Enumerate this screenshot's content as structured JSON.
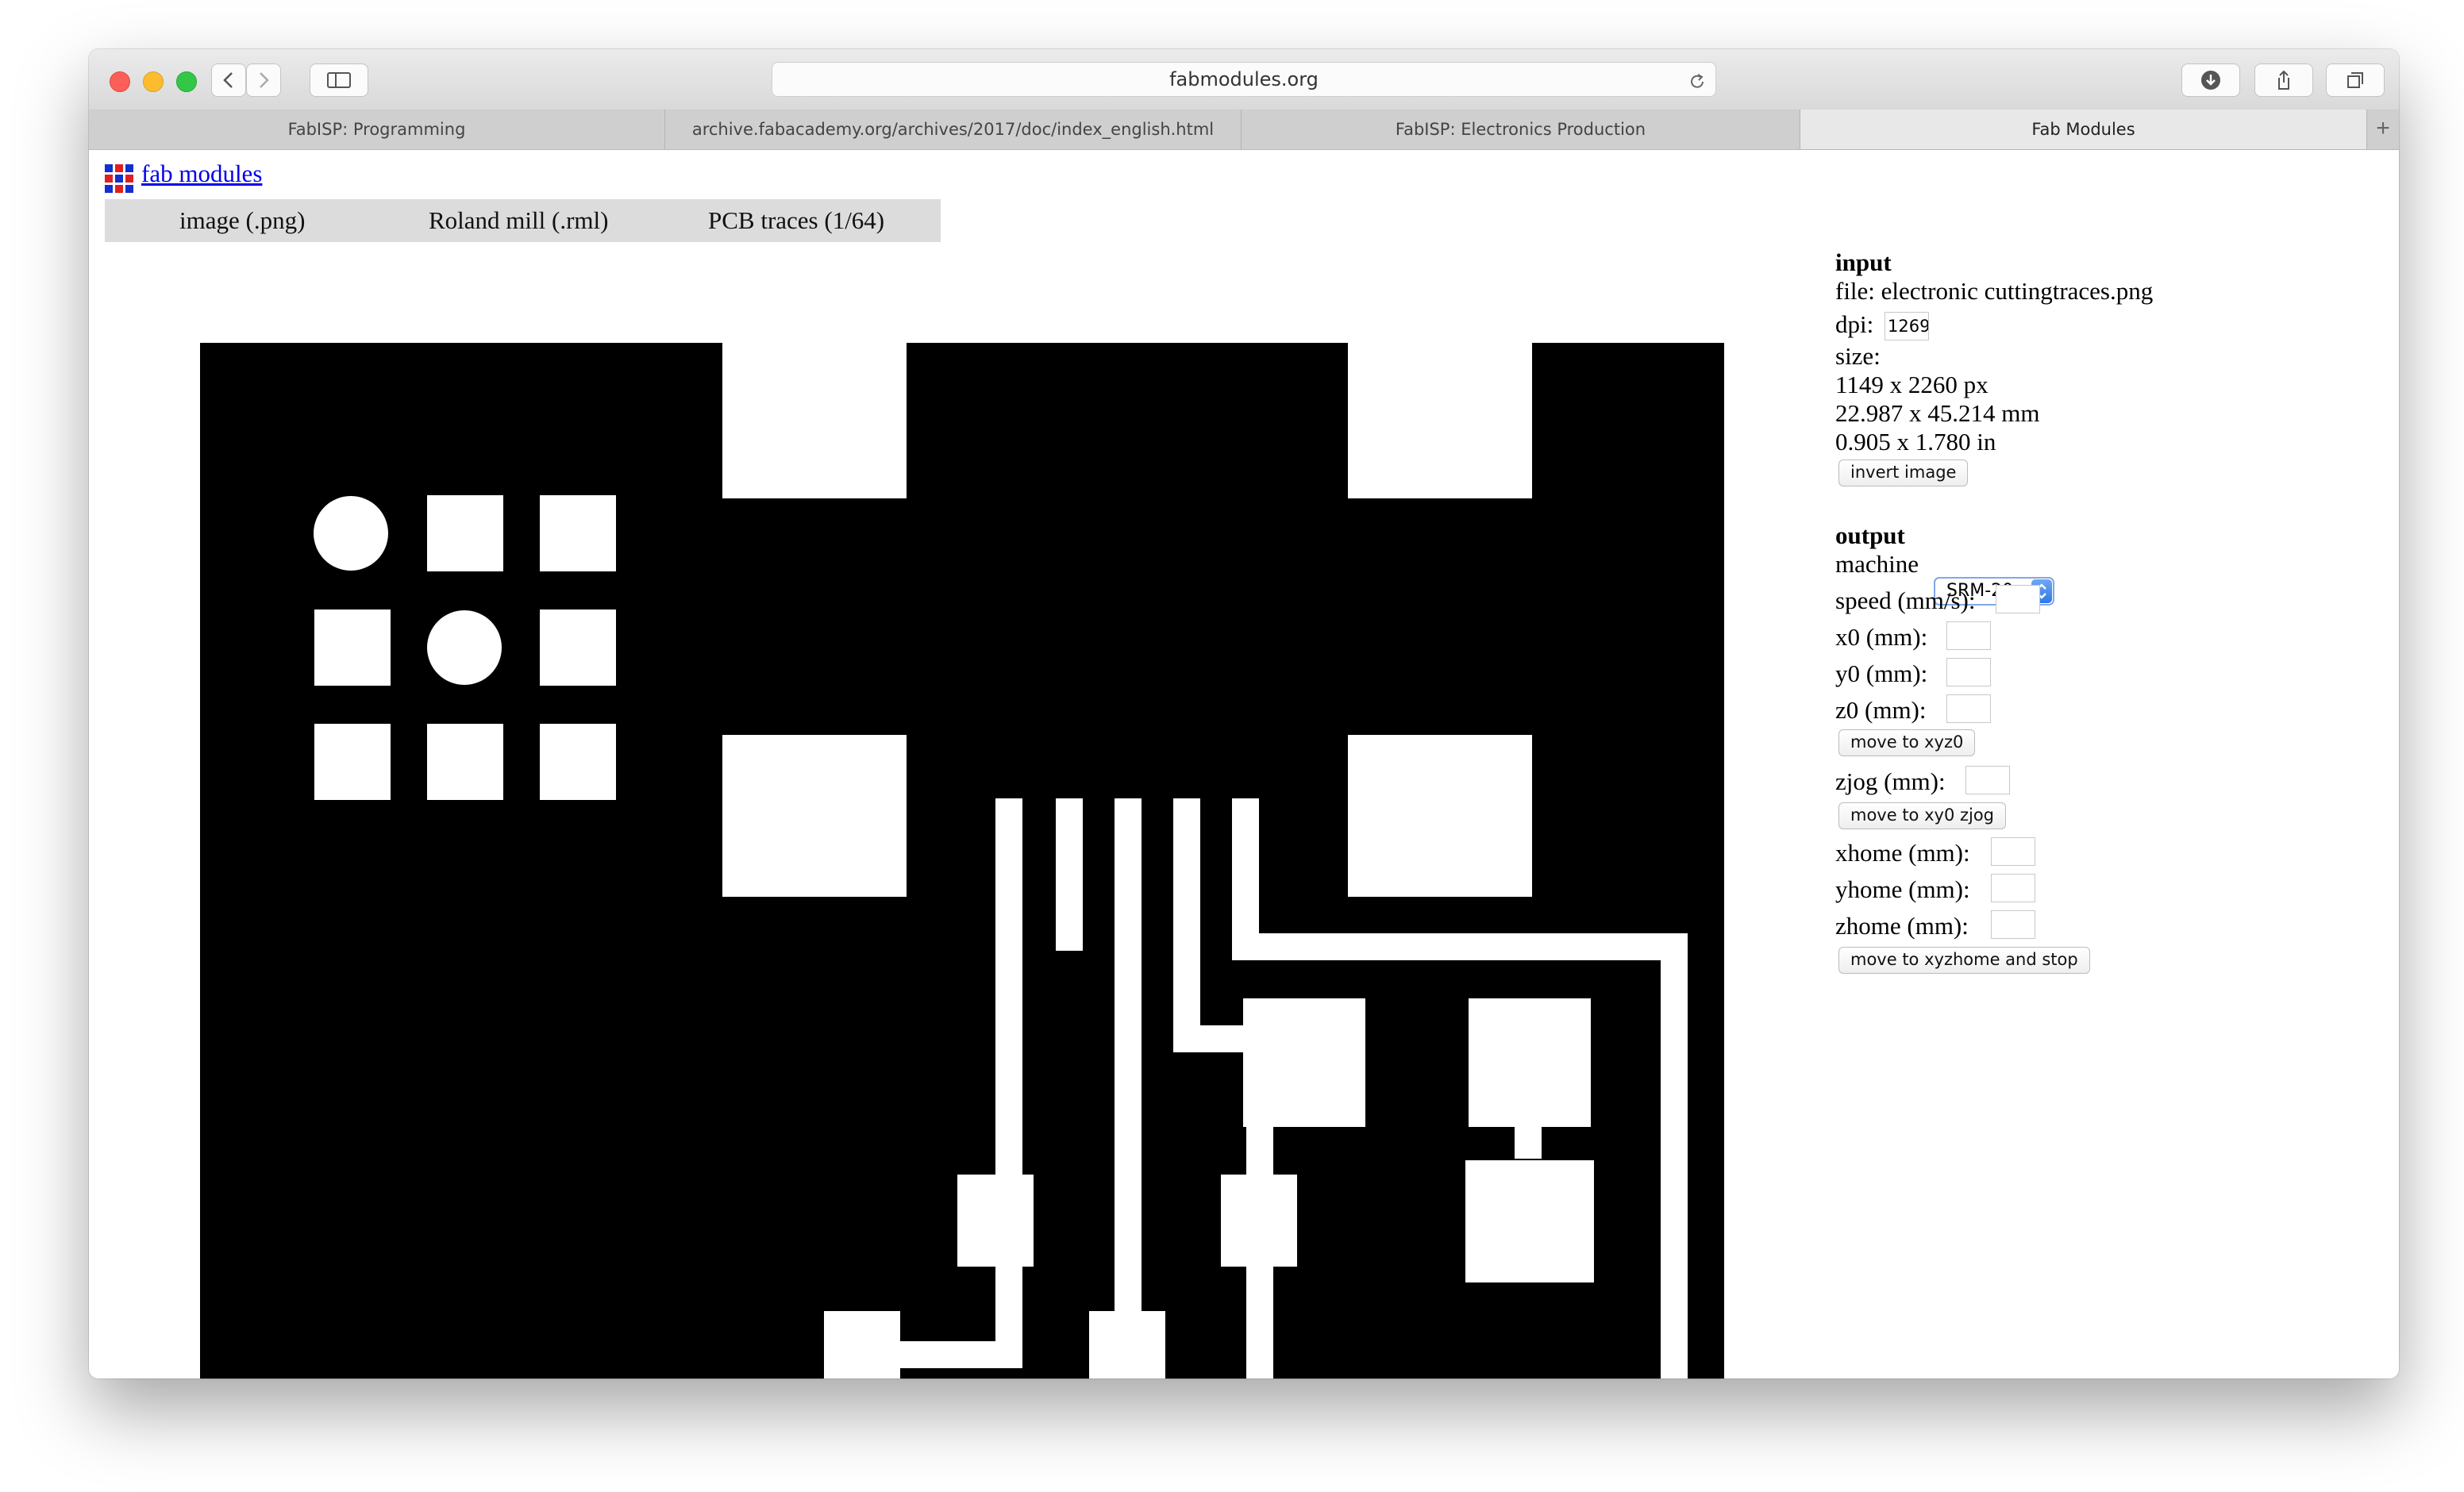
{
  "browser": {
    "address": "fabmodules.org",
    "tabs": [
      {
        "label": "FabISP: Programming",
        "active": false
      },
      {
        "label": "archive.fabacademy.org/archives/2017/doc/index_english.html",
        "active": false
      },
      {
        "label": "FabISP: Electronics Production",
        "active": false
      },
      {
        "label": "Fab Modules",
        "active": true
      }
    ],
    "new_tab_label": "+"
  },
  "page": {
    "site_title": "fab modules",
    "nav": [
      "image (.png)",
      "Roland mill (.rml)",
      "PCB traces (1/64)"
    ]
  },
  "input": {
    "heading": "input",
    "file_line": "file: electronic cuttingtraces.png",
    "dpi_label": "dpi:",
    "dpi_value": "1269",
    "size_label": "size:",
    "size_px": "1149 x 2260 px",
    "size_mm": "22.987 x 45.214 mm",
    "size_in": "0.905 x 1.780 in",
    "invert_button": "invert image"
  },
  "output": {
    "heading": "output",
    "machine_label": "machine",
    "machine_value": "SRM-20",
    "speed_label": "speed (mm/s):",
    "x0_label": "x0 (mm):",
    "y0_label": "y0 (mm):",
    "z0_label": "z0 (mm):",
    "move_xyz0_button": "move to xyz0",
    "zjog_label": "zjog (mm):",
    "move_xy0_zjog_button": "move to xy0 zjog",
    "xhome_label": "xhome (mm):",
    "yhome_label": "yhome (mm):",
    "zhome_label": "zhome (mm):",
    "move_home_button": "move to xyzhome and stop"
  },
  "colors": {
    "link": "#0000ee",
    "nav_bg": "#dcdcdc",
    "board": "#000000",
    "copper_gap": "#ffffff",
    "select_accent": "#2f78e8"
  },
  "icons": [
    "back-icon",
    "forward-icon",
    "sidebar-icon",
    "reload-icon",
    "download-icon",
    "share-icon",
    "tabs-icon",
    "fab-logo-icon"
  ]
}
